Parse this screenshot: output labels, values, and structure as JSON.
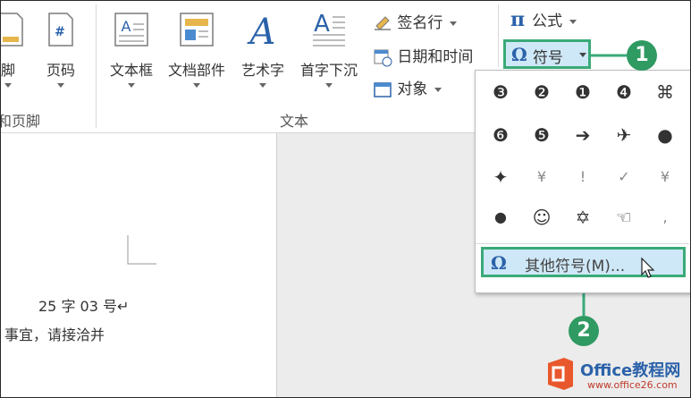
{
  "ribbon": {
    "header_footer": {
      "footer_label": "脚",
      "page_number_label": "页码",
      "group_label": "和页脚"
    },
    "text_group": {
      "textbox_label": "文本框",
      "quickparts_label": "文档部件",
      "wordart_label": "艺术字",
      "dropcap_label": "首字下沉",
      "signature_label": "签名行",
      "datetime_label": "日期和时间",
      "object_label": "对象",
      "group_label": "文本",
      "textbox_icon_text": "A",
      "wordart_icon_text": "A",
      "dropcap_icon_text": "A",
      "pagenum_icon_text": "#"
    },
    "symbols_group": {
      "equation_glyph": "π",
      "equation_label": "公式",
      "symbol_glyph": "Ω",
      "symbol_label": "符号"
    }
  },
  "document": {
    "line1": "25 字 03 号↵",
    "line2": "事宜，请接洽并"
  },
  "symbol_dropdown": {
    "rows": [
      [
        "❸",
        "❷",
        "❶",
        "❹",
        "⌘"
      ],
      [
        "❻",
        "❺",
        "➔",
        "✈",
        "●"
      ],
      [
        "✦",
        "¥",
        "!",
        "✓",
        "¥"
      ],
      [
        "●",
        "☺",
        "✡",
        "☜",
        ","
      ]
    ],
    "more_icon": "Ω",
    "more_label": "其他符号(M)..."
  },
  "callouts": {
    "first": "1",
    "second": "2"
  },
  "watermark": {
    "brand": "Office教程网",
    "url": "www.office26.com"
  },
  "colors": {
    "accent_green": "#2f9a62",
    "highlight_blue": "#cfe8f7",
    "link_blue": "#2b62a9"
  }
}
